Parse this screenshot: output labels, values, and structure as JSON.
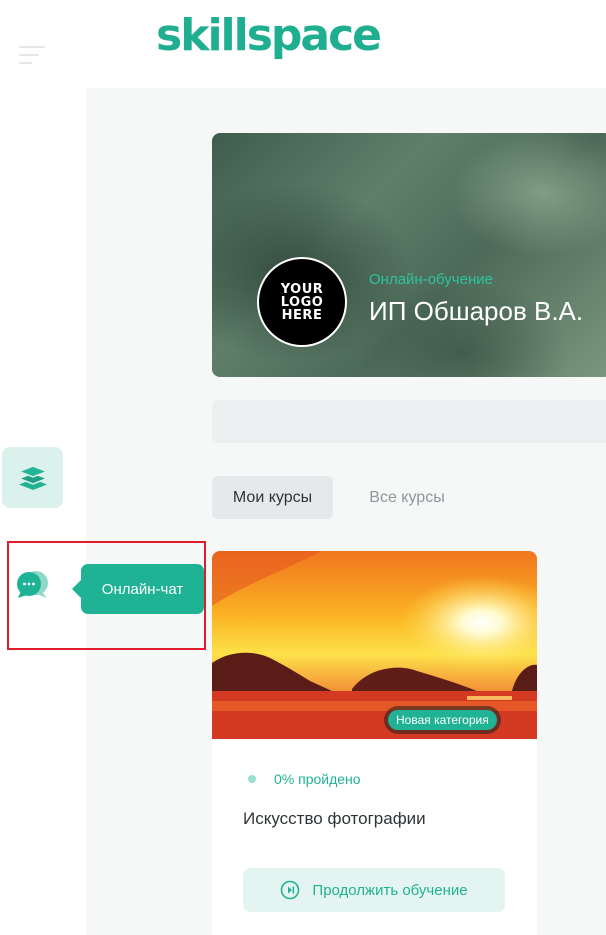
{
  "header": {
    "logo_text": "skillspace"
  },
  "sidebar": {
    "chat_tooltip": "Онлайн-чат"
  },
  "banner": {
    "logo_lines": [
      "YOUR",
      "LOGO",
      "HERE"
    ],
    "subtitle": "Онлайн-обучение",
    "title": "ИП Обшаров В.А."
  },
  "tabs": [
    {
      "label": "Мои курсы",
      "active": true
    },
    {
      "label": "Все курсы",
      "active": false
    }
  ],
  "course": {
    "category_badge": "Новая категория",
    "progress_text": "0% пройдено",
    "progress_value": 0,
    "title": "Искусство фотографии",
    "continue_label": "Продолжить обучение"
  },
  "colors": {
    "accent": "#20b294",
    "highlight_box": "#e21d2b"
  },
  "icons": {
    "menu": "hamburger-icon",
    "courses": "layers-icon",
    "chat": "chat-bubbles-icon",
    "continue": "play-circle-icon"
  }
}
